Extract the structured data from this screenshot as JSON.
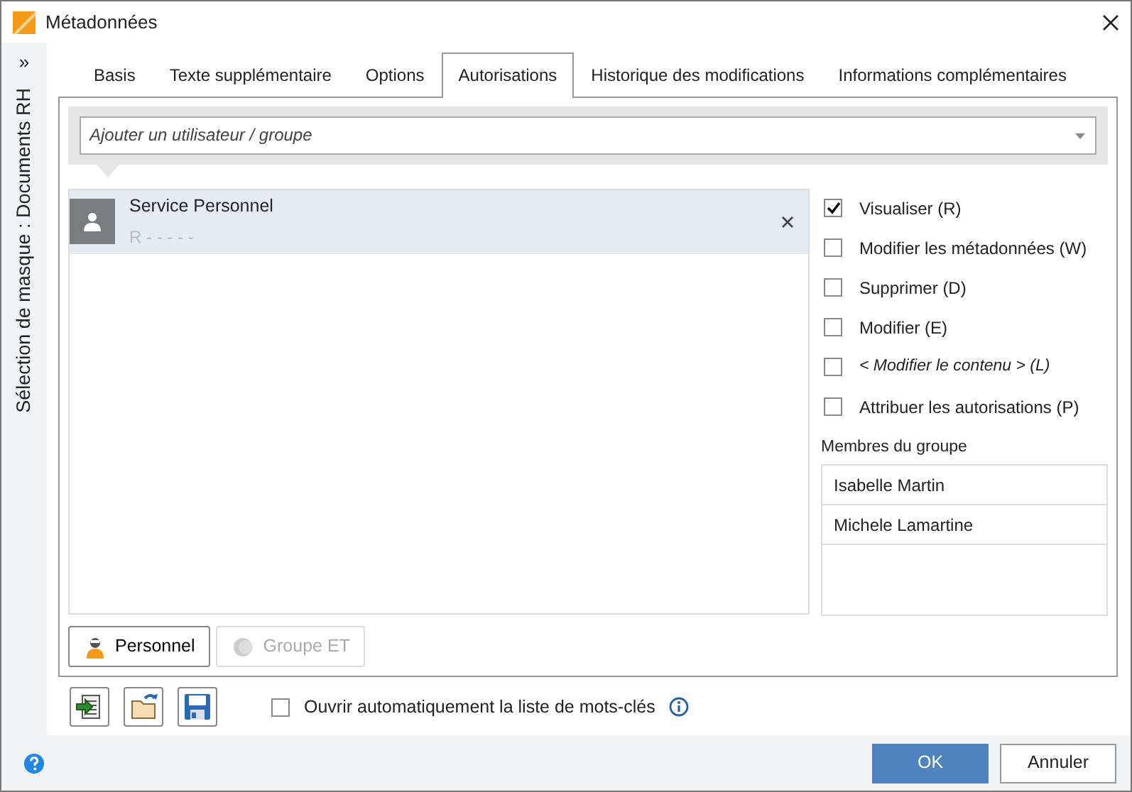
{
  "window": {
    "title": "Métadonnées"
  },
  "sidebar": {
    "toggle": "»",
    "label": "Sélection de masque : Documents RH"
  },
  "tabs": [
    {
      "label": "Basis",
      "selected": false
    },
    {
      "label": "Texte supplémentaire",
      "selected": false
    },
    {
      "label": "Options",
      "selected": false
    },
    {
      "label": "Autorisations",
      "selected": true
    },
    {
      "label": "Historique des modifications",
      "selected": false
    },
    {
      "label": "Informations complémentaires",
      "selected": false
    }
  ],
  "search": {
    "placeholder": "Ajouter un utilisateur / groupe"
  },
  "entries": [
    {
      "name": "Service Personnel",
      "rights": "R - - - - -",
      "selected": true
    }
  ],
  "permissions": [
    {
      "label": "Visualiser (R)",
      "checked": true,
      "kind": "standard"
    },
    {
      "label": "Modifier les métadonnées (W)",
      "checked": false,
      "kind": "standard"
    },
    {
      "label": "Supprimer (D)",
      "checked": false,
      "kind": "standard"
    },
    {
      "label": "Modifier (E)",
      "checked": false,
      "kind": "standard"
    },
    {
      "label": "< Modifier le contenu > (L)",
      "checked": false,
      "kind": "special"
    },
    {
      "label": "Attribuer les autorisations (P)",
      "checked": false,
      "kind": "standard"
    }
  ],
  "members": {
    "label": "Membres du groupe",
    "items": [
      "Isabelle Martin",
      "Michele Lamartine"
    ]
  },
  "group_buttons": [
    {
      "label": "Personnel",
      "disabled": false
    },
    {
      "label": "Groupe ET",
      "disabled": true
    }
  ],
  "auto_open": {
    "label": "Ouvrir automatiquement la liste de mots-clés",
    "checked": false
  },
  "footer_buttons": [
    {
      "label": "OK",
      "kind": "primary"
    },
    {
      "label": "Annuler",
      "kind": "secondary"
    }
  ]
}
